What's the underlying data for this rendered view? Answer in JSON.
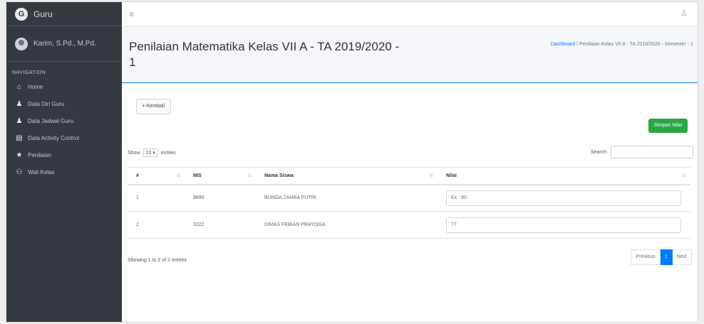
{
  "sidebar": {
    "brand": "Guru",
    "brand_logo": "G",
    "user_name": "Karim, S.Pd., M.Pd.",
    "nav_header": "NAVIGATION",
    "items": [
      {
        "label": "Home",
        "icon": "home-icon",
        "glyph": "⌂"
      },
      {
        "label": "Data Diri Guru",
        "icon": "user-icon",
        "glyph": "♟"
      },
      {
        "label": "Data Jadwal Guru",
        "icon": "user-icon",
        "glyph": "♟"
      },
      {
        "label": "Data Activity Control",
        "icon": "list-icon",
        "glyph": "▤"
      },
      {
        "label": "Penilaian",
        "icon": "star-icon",
        "glyph": "★"
      },
      {
        "label": "Wali Kelas",
        "icon": "users-icon",
        "glyph": "⚇"
      }
    ]
  },
  "topbar": {
    "hamburger": "≡",
    "user_glyph": "♙"
  },
  "header": {
    "title": "Penilaian Matematika Kelas VII A - TA 2019/2020 - 1",
    "breadcrumb_home": "Dashboard",
    "breadcrumb_sep": "/",
    "breadcrumb_current": "Penilaian Kelas VII A - TA 2019/2020 - Semester - 1"
  },
  "actions": {
    "back_label": "⇠Kembali",
    "save_label": "Simpan Nilai"
  },
  "table_controls": {
    "show_label": "Show",
    "entries_value": "10",
    "entries_label": "entries",
    "search_label": "Search:",
    "search_placeholder": ""
  },
  "table": {
    "columns": [
      "#",
      "NIS",
      "Nama Siswa",
      "Nilai"
    ],
    "rows": [
      {
        "no": "1",
        "nis": "8890",
        "nama": "BUNGA ZAHRA PUTRI",
        "nilai_placeholder": "Ex : 80"
      },
      {
        "no": "2",
        "nis": "3222",
        "nama": "DIMAS FEBIAN PRAYOGA",
        "nilai_placeholder": "77"
      }
    ]
  },
  "footer": {
    "info": "Showing 1 to 2 of 2 entries",
    "prev": "Previous",
    "page": "1",
    "next": "Next"
  },
  "colors": {
    "sidebar": "#343a40",
    "primary": "#007bff",
    "success": "#28a745"
  }
}
